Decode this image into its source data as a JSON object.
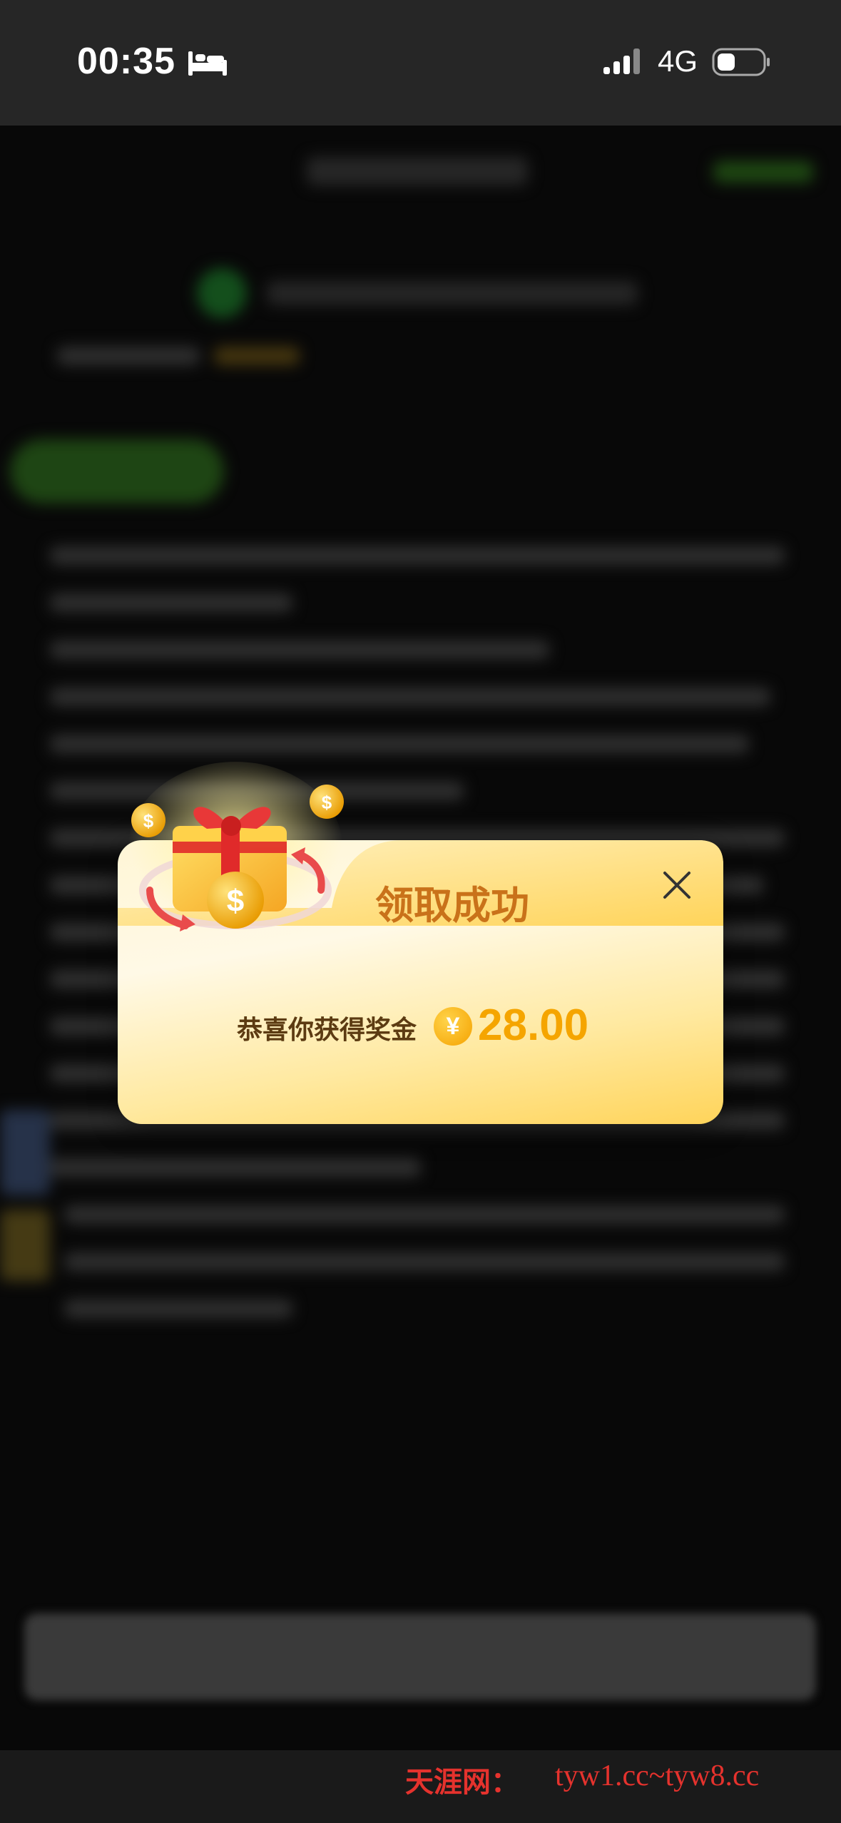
{
  "status_bar": {
    "time": "00:35",
    "network": "4G",
    "icons": [
      "bed-icon",
      "signal-icon",
      "battery-icon"
    ]
  },
  "dialog": {
    "title": "领取成功",
    "prize_label": "恭喜你获得奖金",
    "currency_symbol": "¥",
    "amount": "28.00",
    "icons": [
      "gift-icon",
      "close-icon",
      "coin-icon"
    ],
    "colors": {
      "title": "#c9721a",
      "amount": "#f5a500",
      "text": "#5c3b12"
    }
  },
  "footer": {
    "watermark_label": "天涯网：",
    "watermark_url": "tyw1.cc~tyw8.cc"
  }
}
